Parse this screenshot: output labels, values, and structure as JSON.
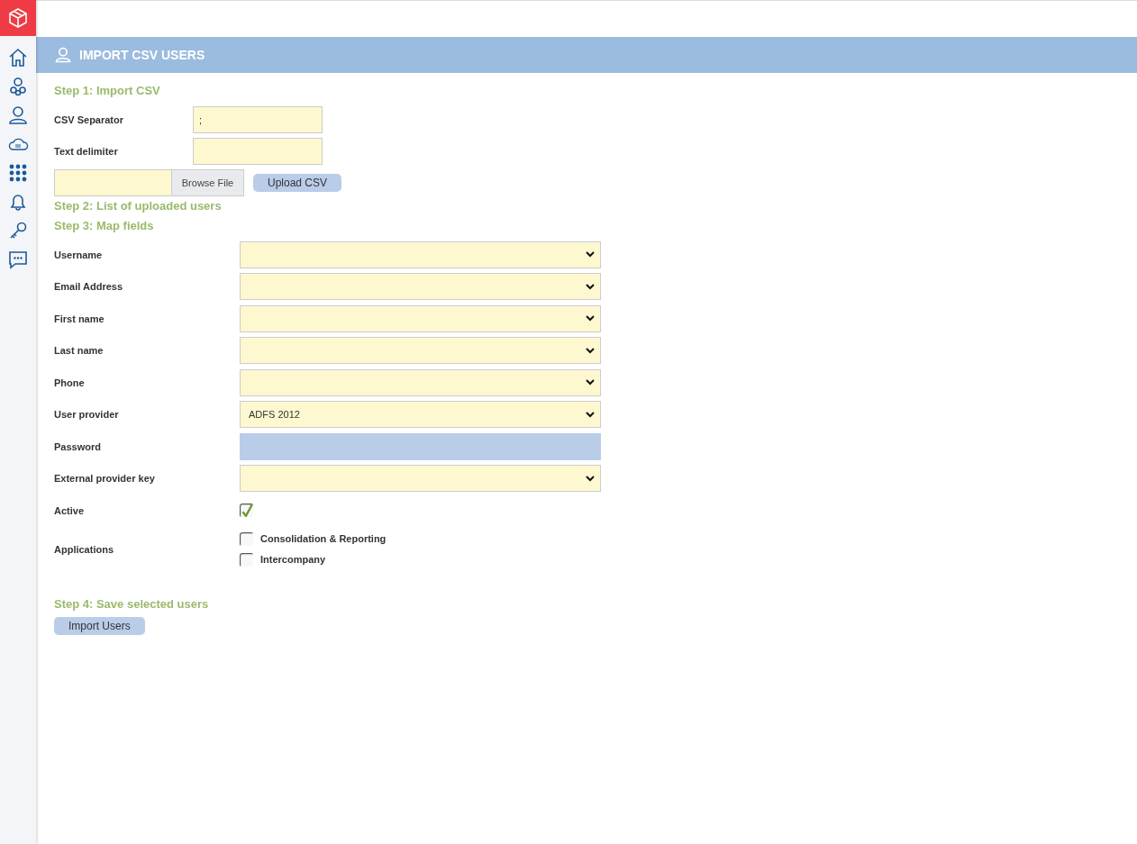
{
  "header": {
    "title": "IMPORT CSV USERS"
  },
  "step1": {
    "heading": "Step 1: Import CSV",
    "fields": [
      {
        "label": "CSV Separator",
        "value": ";"
      },
      {
        "label": "Text delimiter"
      }
    ],
    "file": {
      "browse": "Browse File"
    },
    "upload": "Upload CSV"
  },
  "step2": {
    "heading": "Step 2: List of uploaded users"
  },
  "step3": {
    "heading": "Step 3: Map fields",
    "fields": [
      {
        "kind": "select",
        "label": "Username"
      },
      {
        "kind": "select",
        "label": "Email Address"
      },
      {
        "kind": "select",
        "label": "First name"
      },
      {
        "kind": "select",
        "label": "Last name"
      },
      {
        "kind": "select",
        "label": "Phone"
      },
      {
        "kind": "select",
        "label": "User provider",
        "value": "ADFS 2012"
      },
      {
        "kind": "input",
        "label": "Password",
        "disabled": true
      },
      {
        "kind": "select",
        "label": "External provider key"
      },
      {
        "kind": "checkbox",
        "label": "Active",
        "checked": true
      },
      {
        "kind": "checklist",
        "label": "Applications",
        "options": [
          {
            "label": "Consolidation & Reporting",
            "checked": false
          },
          {
            "label": "Intercompany",
            "checked": false
          }
        ]
      }
    ]
  },
  "step4": {
    "heading": "Step 4: Save selected users",
    "button": "Import Users"
  }
}
